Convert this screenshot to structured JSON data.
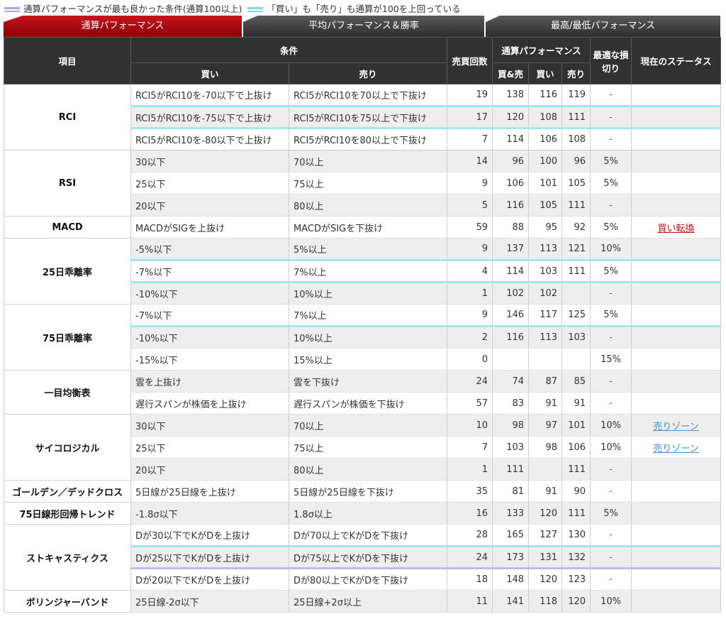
{
  "legend": {
    "purple_text": "通算パフォーマンスが最も良かった条件(通算100以上)",
    "cyan_text": "「買い」も「売り」も通算が100を上回っている",
    "colors": {
      "purple": "#a6a8e6",
      "cyan": "#7fd9e6"
    }
  },
  "tabs": [
    {
      "label": "通算パフォーマンス",
      "active": true
    },
    {
      "label": "平均パフォーマンス＆勝率",
      "active": false
    },
    {
      "label": "最高/最低パフォーマンス",
      "active": false
    }
  ],
  "headers": {
    "item": "項目",
    "condition": "条件",
    "buy": "買い",
    "sell": "売り",
    "trades": "売買回数",
    "performance": "通算パフォーマンス",
    "both": "買&売",
    "perf_buy": "買い",
    "perf_sell": "売り",
    "stoploss": "最適な損切り",
    "status": "現在のステータス"
  },
  "groups": [
    {
      "name": "RCI",
      "rows": [
        {
          "buy": "RCI5がRCI10を-70以下で上抜け",
          "sell": "RCI5がRCI10を70以上で下抜け",
          "trades": "19",
          "both": "138",
          "pbuy": "116",
          "psell": "119",
          "stop": "-",
          "status": ""
        },
        {
          "buy": "RCI5がRCI10を-75以下で上抜け",
          "sell": "RCI5がRCI10を75以上で下抜け",
          "trades": "17",
          "both": "120",
          "pbuy": "108",
          "psell": "111",
          "stop": "-",
          "status": ""
        },
        {
          "buy": "RCI5がRCI10を-80以下で上抜け",
          "sell": "RCI5がRCI10を80以上で下抜け",
          "trades": "7",
          "both": "114",
          "pbuy": "106",
          "psell": "108",
          "stop": "-",
          "status": ""
        }
      ]
    },
    {
      "name": "RSI",
      "rows": [
        {
          "buy": "30以下",
          "sell": "70以上",
          "trades": "14",
          "both": "96",
          "pbuy": "100",
          "psell": "96",
          "stop": "5%",
          "status": ""
        },
        {
          "buy": "25以下",
          "sell": "75以上",
          "trades": "9",
          "both": "106",
          "pbuy": "101",
          "psell": "105",
          "stop": "5%",
          "status": ""
        },
        {
          "buy": "20以下",
          "sell": "80以上",
          "trades": "5",
          "both": "116",
          "pbuy": "105",
          "psell": "111",
          "stop": "-",
          "status": ""
        }
      ]
    },
    {
      "name": "MACD",
      "rows": [
        {
          "buy": "MACDがSIGを上抜け",
          "sell": "MACDがSIGを下抜け",
          "trades": "59",
          "both": "88",
          "pbuy": "95",
          "psell": "92",
          "stop": "5%",
          "status": "買い転換"
        }
      ]
    },
    {
      "name": "25日乖離率",
      "rows": [
        {
          "buy": "-5%以下",
          "sell": "5%以上",
          "trades": "9",
          "both": "137",
          "pbuy": "113",
          "psell": "121",
          "stop": "10%",
          "status": ""
        },
        {
          "buy": "-7%以下",
          "sell": "7%以上",
          "trades": "4",
          "both": "114",
          "pbuy": "103",
          "psell": "111",
          "stop": "5%",
          "status": ""
        },
        {
          "buy": "-10%以下",
          "sell": "10%以上",
          "trades": "1",
          "both": "102",
          "pbuy": "102",
          "psell": "",
          "stop": "-",
          "status": ""
        }
      ]
    },
    {
      "name": "75日乖離率",
      "rows": [
        {
          "buy": "-7%以下",
          "sell": "7%以上",
          "trades": "9",
          "both": "146",
          "pbuy": "117",
          "psell": "125",
          "stop": "5%",
          "status": ""
        },
        {
          "buy": "-10%以下",
          "sell": "10%以上",
          "trades": "2",
          "both": "116",
          "pbuy": "113",
          "psell": "103",
          "stop": "-",
          "status": ""
        },
        {
          "buy": "-15%以下",
          "sell": "15%以上",
          "trades": "0",
          "both": "",
          "pbuy": "",
          "psell": "",
          "stop": "15%",
          "status": ""
        }
      ]
    },
    {
      "name": "一目均衡表",
      "rows": [
        {
          "buy": "雲を上抜け",
          "sell": "雲を下抜け",
          "trades": "24",
          "both": "74",
          "pbuy": "87",
          "psell": "85",
          "stop": "-",
          "status": ""
        },
        {
          "buy": "遅行スパンが株価を上抜け",
          "sell": "遅行スパンが株価を下抜け",
          "trades": "57",
          "both": "83",
          "pbuy": "91",
          "psell": "91",
          "stop": "-",
          "status": ""
        }
      ]
    },
    {
      "name": "サイコロジカル",
      "rows": [
        {
          "buy": "30以下",
          "sell": "70以上",
          "trades": "10",
          "both": "98",
          "pbuy": "97",
          "psell": "101",
          "stop": "10%",
          "status": "売りゾーン"
        },
        {
          "buy": "25以下",
          "sell": "75以上",
          "trades": "7",
          "both": "103",
          "pbuy": "98",
          "psell": "106",
          "stop": "10%",
          "status": "売りゾーン"
        },
        {
          "buy": "20以下",
          "sell": "80以上",
          "trades": "1",
          "both": "111",
          "pbuy": "",
          "psell": "111",
          "stop": "-",
          "status": ""
        }
      ]
    },
    {
      "name": "ゴールデン／デッドクロス",
      "rows": [
        {
          "buy": "5日線が25日線を上抜け",
          "sell": "5日線が25日線を下抜け",
          "trades": "35",
          "both": "81",
          "pbuy": "91",
          "psell": "90",
          "stop": "-",
          "status": ""
        }
      ]
    },
    {
      "name": "75日線形回帰トレンド",
      "rows": [
        {
          "buy": "-1.8σ以下",
          "sell": "1.8σ以上",
          "trades": "16",
          "both": "133",
          "pbuy": "120",
          "psell": "111",
          "stop": "5%",
          "status": ""
        }
      ]
    },
    {
      "name": "ストキャスティクス",
      "rows": [
        {
          "buy": "Dが30以下でKがDを上抜け",
          "sell": "Dが70以上でKがDを下抜け",
          "trades": "28",
          "both": "165",
          "pbuy": "127",
          "psell": "130",
          "stop": "-",
          "status": ""
        },
        {
          "buy": "Dが25以下でKがDを上抜け",
          "sell": "Dが75以上でKがDを下抜け",
          "trades": "24",
          "both": "173",
          "pbuy": "131",
          "psell": "132",
          "stop": "-",
          "status": ""
        },
        {
          "buy": "Dが20以下でKがDを上抜け",
          "sell": "Dが80以上でKがDを下抜け",
          "trades": "18",
          "both": "148",
          "pbuy": "120",
          "psell": "123",
          "stop": "-",
          "status": ""
        }
      ]
    },
    {
      "name": "ボリンジャーバンド",
      "rows": [
        {
          "buy": "25日線-2σ以下",
          "sell": "25日線+2σ以上",
          "trades": "11",
          "both": "141",
          "pbuy": "118",
          "psell": "120",
          "stop": "10%",
          "status": ""
        }
      ]
    }
  ]
}
